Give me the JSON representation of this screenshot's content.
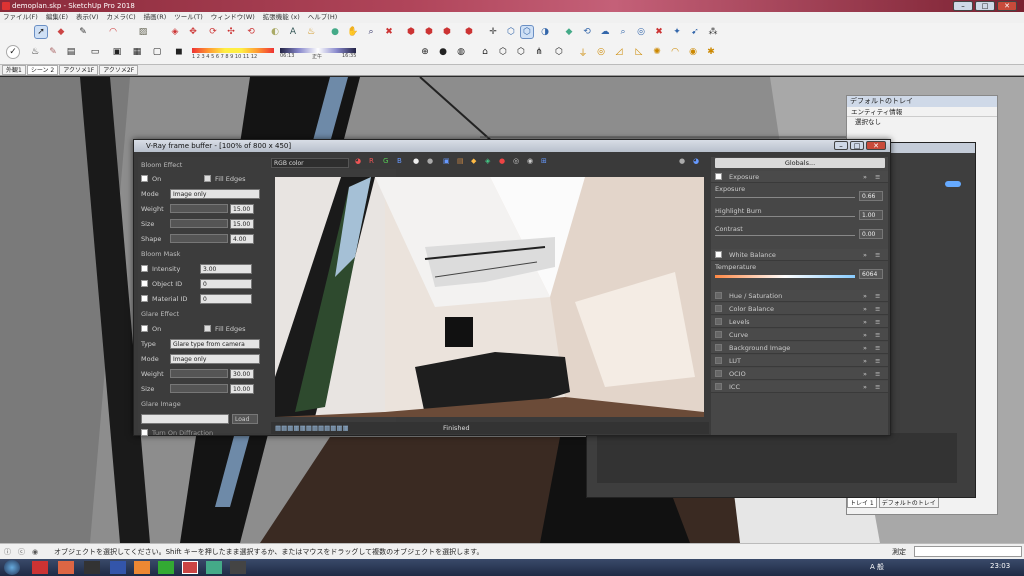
{
  "window": {
    "title": "demoplan.skp - SketchUp Pro 2018",
    "min": "–",
    "max": "□",
    "close": "✕"
  },
  "menu": [
    "ファイル(F)",
    "編集(E)",
    "表示(V)",
    "カメラ(C)",
    "描画(R)",
    "ツール(T)",
    "ウィンドウ(W)",
    "拡張機能 (x)",
    "ヘルプ(H)"
  ],
  "toolbar": {
    "shadow_months": "1 2 3 4 5 6 7 8 9 10 11 12",
    "time_start": "06:13",
    "time_mid": "正午",
    "time_end": "16:35"
  },
  "tabs": [
    "外観1",
    "シーン 2",
    "アクソメ1F",
    "アクソメ2F"
  ],
  "tray": {
    "title": "デフォルトのトレイ",
    "section": "エンティティ情報",
    "selection": "選択なし",
    "tab1": "トレイ 1",
    "tab2": "デフォルトのトレイ"
  },
  "vfb": {
    "title": "V-Ray frame buffer - [100% of 800 x 450]",
    "channel": "RGB color",
    "status": "Finished",
    "left": {
      "bloom_title": "Bloom Effect",
      "on": "On",
      "fill_edges": "Fill Edges",
      "mode_label": "Mode",
      "mode_value": "Image only",
      "weight_label": "Weight",
      "weight_value": "15.00",
      "size_label": "Size",
      "size_value": "15.00",
      "shape_label": "Shape",
      "shape_value": "4.00",
      "mask_title": "Bloom Mask",
      "intensity_label": "Intensity",
      "intensity_value": "3.00",
      "objid_label": "Object ID",
      "objid_value": "0",
      "matid_label": "Material ID",
      "matid_value": "0",
      "glare_title": "Glare Effect",
      "g_on": "On",
      "g_fill_edges": "Fill Edges",
      "type_label": "Type",
      "type_value": "Glare type from camera",
      "g_mode_label": "Mode",
      "g_mode_value": "Image only",
      "g_weight_label": "Weight",
      "g_weight_value": "30.00",
      "g_size_label": "Size",
      "g_size_value": "10.00",
      "glare_image": "Glare Image",
      "load": "Load",
      "diffraction": "Turn On Diffraction"
    },
    "right": {
      "globals": "Globals...",
      "exposure": "Exposure",
      "exposure_label": "Exposure",
      "exposure_value": "0.66",
      "highlight_label": "Highlight Burn",
      "highlight_value": "1.00",
      "contrast_label": "Contrast",
      "contrast_value": "0.00",
      "wb": "White Balance",
      "temp_label": "Temperature",
      "temp_value": "6064",
      "layers": [
        "Hue / Saturation",
        "Color Balance",
        "Levels",
        "Curve",
        "Background Image",
        "LUT",
        "OCIO",
        "ICC"
      ]
    }
  },
  "status": {
    "message": "オブジェクトを選択してください。Shift キーを押したまま選択するか、またはマウスをドラッグして複数のオブジェクトを選択します。",
    "measure": "測定"
  },
  "taskbar": {
    "clock": "23:03",
    "lang": "A 般"
  }
}
